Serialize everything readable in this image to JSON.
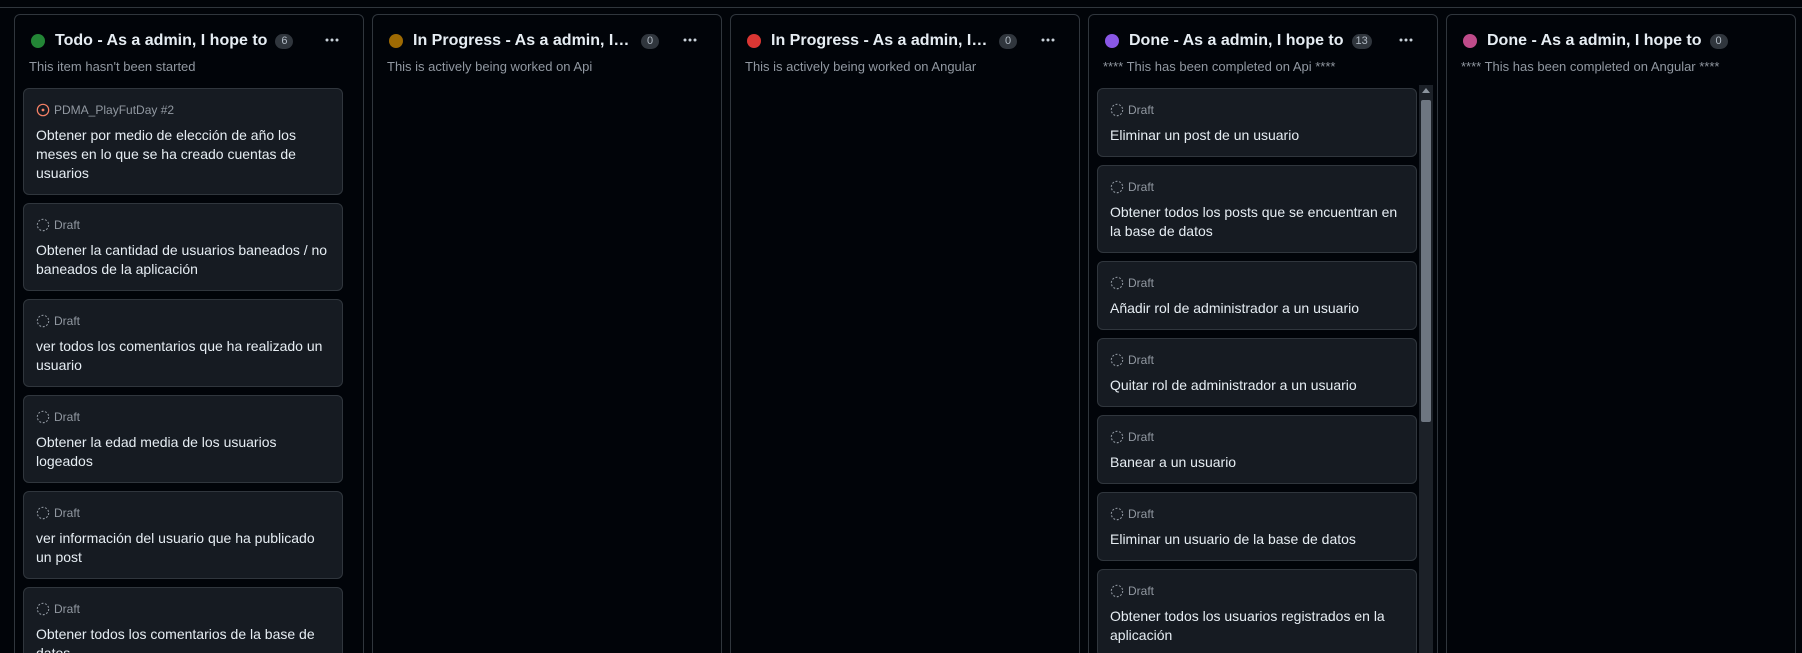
{
  "colors": {
    "todo": "#238636",
    "in_progress_api": "#9e6a03",
    "in_progress_angular": "#da3633",
    "done_api": "#8957e5",
    "done_angular": "#bf4b8a",
    "open_issue": "#f78166"
  },
  "columns": [
    {
      "title": "Todo - As a admin, I hope to",
      "count": "6",
      "status_color": "#238636",
      "description": "This item hasn't been started",
      "cards": [
        {
          "type": "issue",
          "meta": "PDMA_PlayFutDay #2",
          "icon": "issue-open-icon",
          "title": "Obtener por medio de elección de año los meses en lo que se ha creado cuentas de usuarios"
        },
        {
          "type": "draft",
          "meta": "Draft",
          "icon": "draft-icon",
          "title": "Obtener la cantidad de usuarios baneados / no baneados de la aplicación"
        },
        {
          "type": "draft",
          "meta": "Draft",
          "icon": "draft-icon",
          "title": "ver todos los comentarios que ha realizado un usuario"
        },
        {
          "type": "draft",
          "meta": "Draft",
          "icon": "draft-icon",
          "title": "Obtener la edad media de los usuarios logeados"
        },
        {
          "type": "draft",
          "meta": "Draft",
          "icon": "draft-icon",
          "title": "ver información del usuario que ha publicado un post"
        },
        {
          "type": "draft",
          "meta": "Draft",
          "icon": "draft-icon",
          "title": "Obtener todos los comentarios de la base de datos"
        }
      ]
    },
    {
      "title": "In Progress - As a admin, I hope to",
      "count": "0",
      "status_color": "#9e6a03",
      "description": "This is actively being worked on Api",
      "cards": []
    },
    {
      "title": "In Progress - As a admin, I hope to",
      "count": "0",
      "status_color": "#da3633",
      "description": "This is actively being worked on Angular",
      "cards": []
    },
    {
      "title": "Done - As a admin, I hope to",
      "count": "13",
      "status_color": "#8957e5",
      "description": "**** This has been completed on Api ****",
      "cards": [
        {
          "type": "draft",
          "meta": "Draft",
          "icon": "draft-icon",
          "title": "Eliminar un post de un usuario"
        },
        {
          "type": "draft",
          "meta": "Draft",
          "icon": "draft-icon",
          "title": "Obtener todos los posts que se encuentran en la base de datos"
        },
        {
          "type": "draft",
          "meta": "Draft",
          "icon": "draft-icon",
          "title": "Añadir rol de administrador a un usuario"
        },
        {
          "type": "draft",
          "meta": "Draft",
          "icon": "draft-icon",
          "title": "Quitar rol de administrador a un usuario"
        },
        {
          "type": "draft",
          "meta": "Draft",
          "icon": "draft-icon",
          "title": "Banear a un usuario"
        },
        {
          "type": "draft",
          "meta": "Draft",
          "icon": "draft-icon",
          "title": "Eliminar un usuario de la base de datos"
        },
        {
          "type": "draft",
          "meta": "Draft",
          "icon": "draft-icon",
          "title": "Obtener todos los usuarios registrados en la aplicación"
        }
      ]
    },
    {
      "title": "Done - As a admin, I hope to",
      "count": "0",
      "status_color": "#bf4b8a",
      "description": "**** This has been completed on Angular ****",
      "cards": []
    }
  ],
  "icons": {
    "column_menu": "kebab-horizontal-icon"
  }
}
